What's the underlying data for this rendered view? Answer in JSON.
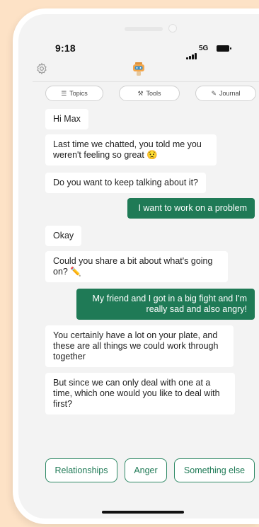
{
  "status": {
    "time": "9:18",
    "network": "5G"
  },
  "tabs": [
    {
      "label": "Topics",
      "icon": "list-icon"
    },
    {
      "label": "Tools",
      "icon": "toolbox-icon"
    },
    {
      "label": "Journal",
      "icon": "pencil-square-icon"
    }
  ],
  "messages": [
    {
      "from": "bot",
      "text": "Hi Max"
    },
    {
      "from": "bot",
      "text": "Last time we chatted, you told me you weren't feeling so great 😟"
    },
    {
      "from": "bot",
      "text": "Do you want to keep talking about it?"
    },
    {
      "from": "user",
      "text": "I want to work on a problem"
    },
    {
      "from": "bot",
      "text": "Okay"
    },
    {
      "from": "bot",
      "text": "Could you share a bit about what's going on? ✏️"
    },
    {
      "from": "user",
      "text": "My friend and I got in a big fight and I'm really sad and also angry!"
    },
    {
      "from": "bot",
      "text": "You certainly have a lot on your plate, and these are all things we could work through together"
    },
    {
      "from": "bot",
      "text": "But since we can only deal with one at a time, which one would you like to deal with first?"
    }
  ],
  "quick_replies": [
    "Relationships",
    "Anger",
    "Something else"
  ],
  "colors": {
    "user_bubble": "#1f7a56",
    "accent": "#2f8a66",
    "background": "#fde2c6"
  }
}
